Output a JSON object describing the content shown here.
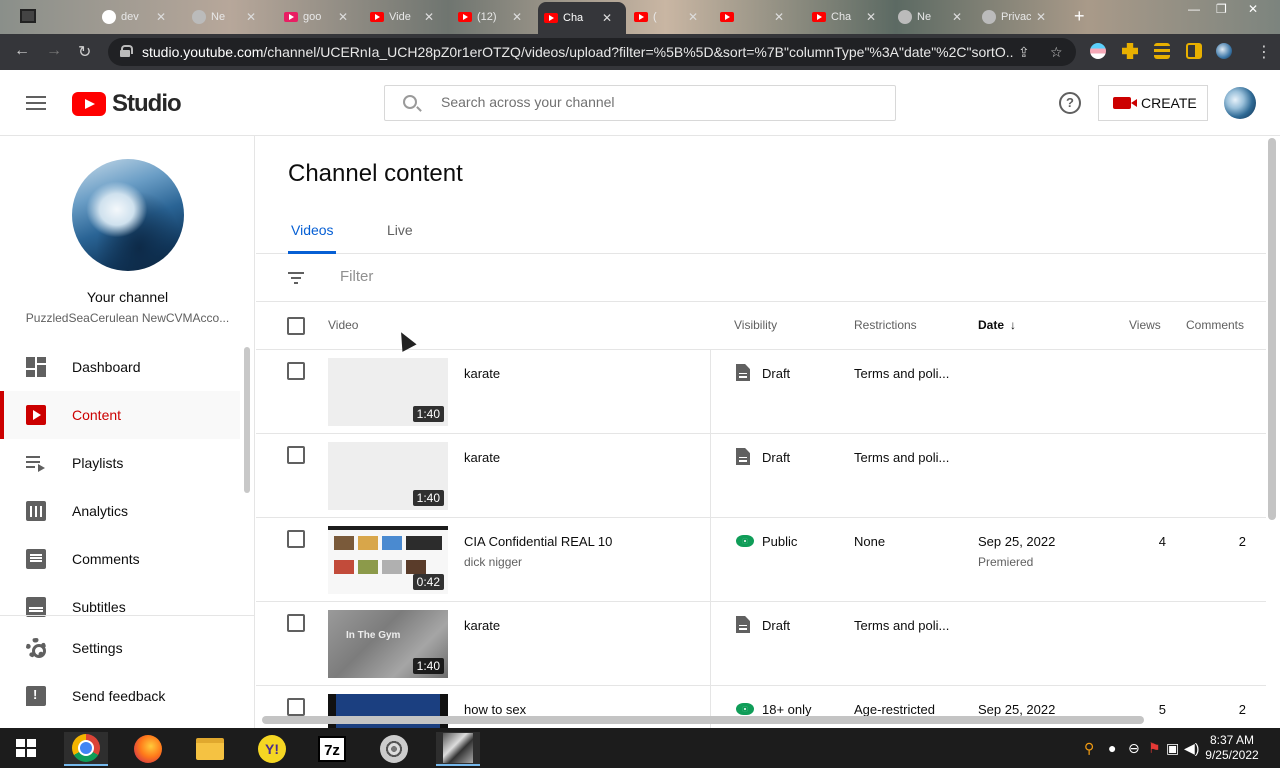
{
  "browser": {
    "tabs": [
      {
        "label": "",
        "icon": "generic-icon",
        "favicon": "google"
      },
      {
        "label": "dev",
        "icon": "google-icon",
        "favicon": "g"
      },
      {
        "label": "Ne",
        "icon": "globe-icon",
        "favicon": "gr"
      },
      {
        "label": "goo",
        "icon": "download-icon",
        "favicon": "dl"
      },
      {
        "label": "Vide",
        "icon": "youtube-icon",
        "favicon": "yt"
      },
      {
        "label": "(12)",
        "icon": "youtube-icon",
        "favicon": "yt"
      },
      {
        "label": "Cha",
        "icon": "youtube-icon",
        "favicon": "yt",
        "active": true
      },
      {
        "label": "(",
        "icon": "youtube-icon",
        "favicon": "yt"
      },
      {
        "label": "",
        "icon": "youtube-icon",
        "favicon": "yt"
      },
      {
        "label": "Cha",
        "icon": "youtube-icon",
        "favicon": "yt"
      },
      {
        "label": "Ne",
        "icon": "globe-icon",
        "favicon": "gr"
      },
      {
        "label": "Privacy",
        "icon": "globe-icon",
        "favicon": "gr"
      }
    ],
    "new_tab": "+",
    "url_host": "studio.youtube.com",
    "url_path": "/channel/UCERnIa_UCH28pZ0r1erOTZQ/videos/upload?filter=%5B%5D&sort=%7B\"columnType\"%3A\"date\"%2C\"sortO..."
  },
  "header": {
    "logo_text": "Studio",
    "search_placeholder": "Search across your channel",
    "help_label": "?",
    "create_label": "CREATE"
  },
  "sidebar": {
    "channel_title": "Your channel",
    "channel_name": "PuzzledSeaCerulean NewCVMAcco...",
    "items": [
      {
        "label": "Dashboard",
        "icon": "dashboard-icon"
      },
      {
        "label": "Content",
        "icon": "content-icon",
        "active": true
      },
      {
        "label": "Playlists",
        "icon": "playlists-icon"
      },
      {
        "label": "Analytics",
        "icon": "analytics-icon"
      },
      {
        "label": "Comments",
        "icon": "comments-icon"
      },
      {
        "label": "Subtitles",
        "icon": "subtitles-icon"
      }
    ],
    "footer": [
      {
        "label": "Settings",
        "icon": "gear-icon"
      },
      {
        "label": "Send feedback",
        "icon": "feedback-icon"
      }
    ]
  },
  "main": {
    "title": "Channel content",
    "tabs": [
      {
        "label": "Videos",
        "active": true
      },
      {
        "label": "Live"
      }
    ],
    "filter_placeholder": "Filter",
    "columns": {
      "video": "Video",
      "visibility": "Visibility",
      "restrictions": "Restrictions",
      "date": "Date",
      "date_sort_arrow": "↓",
      "views": "Views",
      "comments": "Comments"
    },
    "rows": [
      {
        "title": "karate",
        "description": "",
        "duration": "1:40",
        "thumb": "blank",
        "visibility": "Draft",
        "visibility_icon": "draft-icon",
        "restrictions": "Terms and poli...",
        "date": "",
        "date_sub": "",
        "views": "",
        "comments": ""
      },
      {
        "title": "karate",
        "description": "",
        "duration": "1:40",
        "thumb": "blank",
        "visibility": "Draft",
        "visibility_icon": "draft-icon",
        "restrictions": "Terms and poli...",
        "date": "",
        "date_sub": "",
        "views": "",
        "comments": ""
      },
      {
        "title": "CIA Confidential REAL 10",
        "description": "dick nigger",
        "duration": "0:42",
        "thumb": "cia",
        "visibility": "Public",
        "visibility_icon": "eye-icon",
        "restrictions": "None",
        "date": "Sep 25, 2022",
        "date_sub": "Premiered",
        "views": "4",
        "comments": "2"
      },
      {
        "title": "karate",
        "description": "",
        "duration": "1:40",
        "thumb": "gym",
        "thumb_text": "In The Gym",
        "visibility": "Draft",
        "visibility_icon": "draft-icon",
        "restrictions": "Terms and poli...",
        "date": "",
        "date_sub": "",
        "views": "",
        "comments": ""
      },
      {
        "title": "how to sex",
        "description": "",
        "duration": "",
        "thumb": "sex",
        "visibility": "18+ only",
        "visibility_icon": "eye-icon",
        "restrictions": "Age-restricted",
        "date": "Sep 25, 2022",
        "date_sub": "",
        "views": "5",
        "comments": "2"
      }
    ]
  },
  "taskbar": {
    "apps": [
      "chrome-icon",
      "firefox-icon",
      "file-explorer-icon",
      "yahoo-messenger-icon",
      "7zip-icon",
      "media-player-icon",
      "art-icon"
    ],
    "time": "8:37 AM",
    "date": "9/25/2022"
  }
}
